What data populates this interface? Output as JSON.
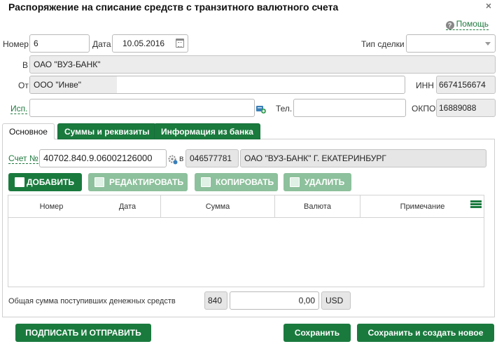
{
  "window": {
    "title": "Распоряжение на списание средств с транзитного валютного счета",
    "help": "Помощь"
  },
  "form": {
    "number_label": "Номер",
    "number_value": "6",
    "date_label": "Дата",
    "date_value": "10.05.2016",
    "deal_type_label": "Тип сделки",
    "deal_type_value": "",
    "to_label": "В",
    "to_value": "ОАО \"ВУЗ-БАНК\"",
    "from_label": "От",
    "from_value": "ООО \"Инве\"",
    "inn_label": "ИНН",
    "inn_value": "6674156674",
    "executor_label": "Исп.",
    "executor_value": "",
    "phone_label": "Тел.",
    "phone_value": "",
    "okpo_label": "ОКПО",
    "okpo_value": "16889088"
  },
  "tabs": [
    {
      "label": "Основное"
    },
    {
      "label": "Суммы и реквизиты"
    },
    {
      "label": "Информация из банка"
    }
  ],
  "account": {
    "label": "Счет №",
    "value": "40702.840.9.06002126000",
    "in_label": "в",
    "bik": "046577781",
    "bank": "ОАО \"ВУЗ-БАНК\" Г. ЕКАТЕРИНБУРГ"
  },
  "actions": {
    "add": "ДОБАВИТЬ",
    "edit": "РЕДАКТИРОВАТЬ",
    "copy": "КОПИРОВАТЬ",
    "delete": "УДАЛИТЬ"
  },
  "table": {
    "columns": [
      "Номер",
      "Дата",
      "Сумма",
      "Валюта",
      "Примечание"
    ],
    "rows": []
  },
  "total": {
    "label": "Общая сумма поступивших денежных средств",
    "currency_code": "840",
    "amount": "0,00",
    "currency": "USD"
  },
  "footer": {
    "sign_send": "ПОДПИСАТЬ И ОТПРАВИТЬ",
    "save": "Сохранить",
    "save_new": "Сохранить и создать новое"
  },
  "colors": {
    "accent": "#1a7a3e",
    "accent_light": "#8dc09c",
    "link": "#1f7a3e"
  }
}
